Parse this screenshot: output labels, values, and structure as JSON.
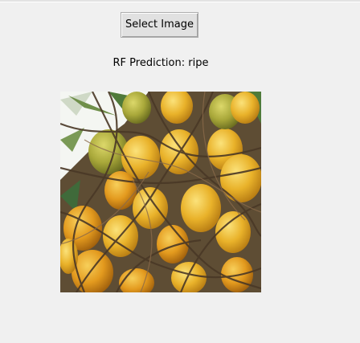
{
  "app": {
    "select_button_label": "Select Image",
    "prediction_text": "RF Prediction: ripe"
  },
  "image": {
    "subject_icon": "betel-nut-cluster-photo",
    "colors": {
      "fruit_yellow": "#e9b92a",
      "fruit_green": "#a9a83a",
      "sky": "#f4f6f2",
      "leaf": "#4f7a3a",
      "stalk": "#5b4632"
    }
  }
}
